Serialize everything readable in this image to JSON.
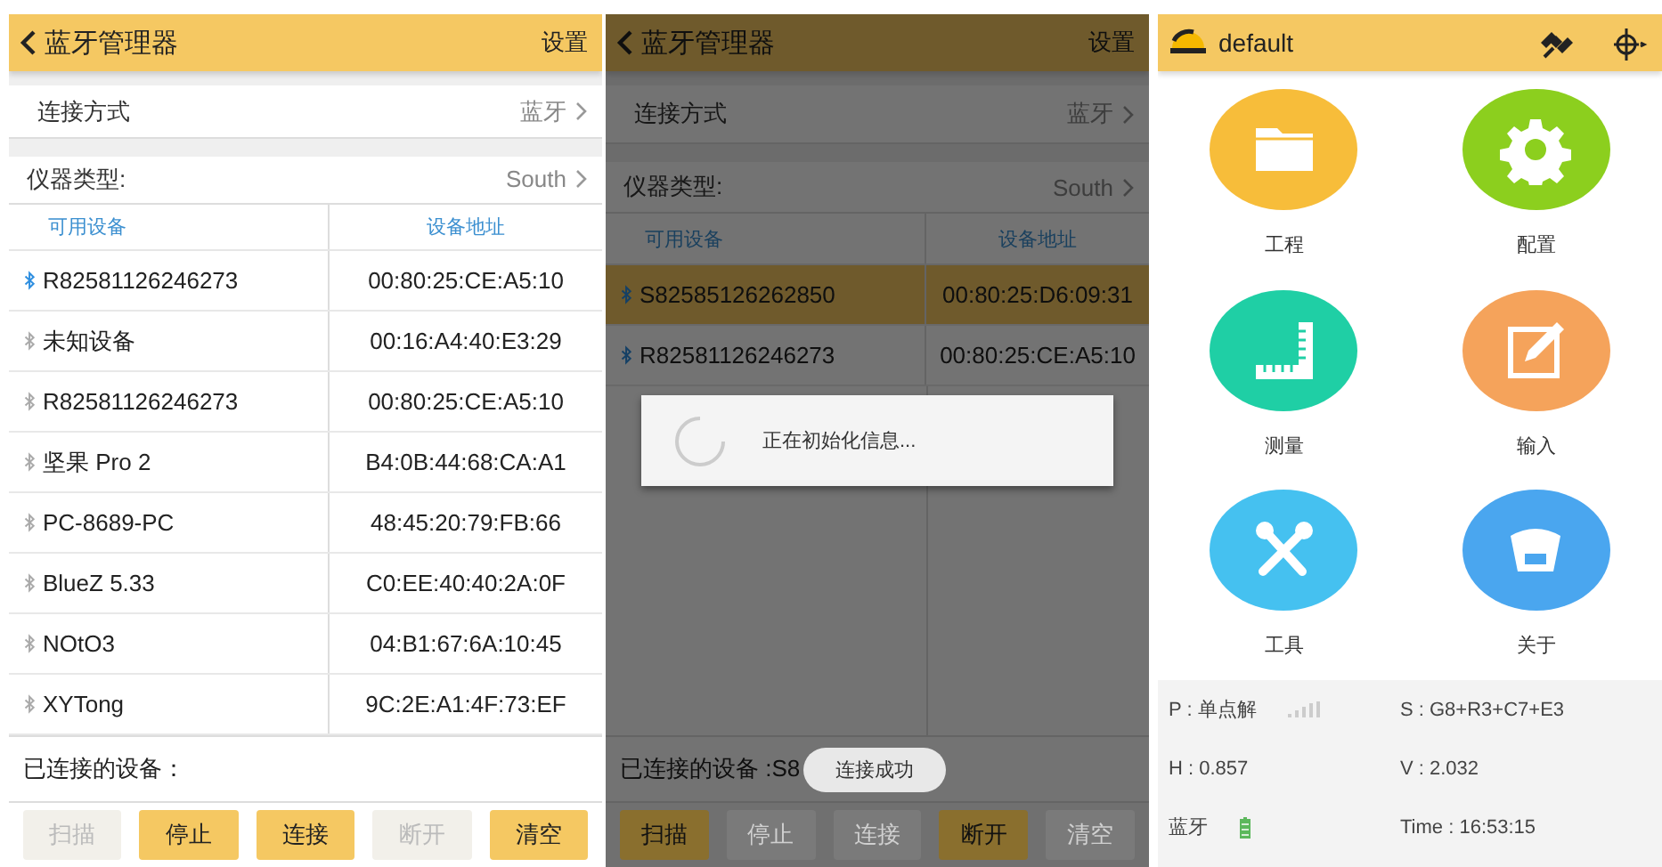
{
  "bluetooth_manager": {
    "title": "蓝牙管理器",
    "action": "设置",
    "dimmed": false,
    "settings": [
      {
        "label": "连接方式",
        "value": "蓝牙"
      },
      {
        "label": "仪器类型:",
        "value": "South"
      }
    ],
    "columns": [
      "可用设备",
      "设备地址"
    ],
    "devices": [
      {
        "name": "R82581126246273",
        "address": "00:80:25:CE:A5:10",
        "paired": true,
        "selected": false
      },
      {
        "name": "未知设备",
        "address": "00:16:A4:40:E3:29",
        "paired": false,
        "selected": false
      },
      {
        "name": "R82581126246273",
        "address": "00:80:25:CE:A5:10",
        "paired": false,
        "selected": false
      },
      {
        "name": "坚果 Pro 2",
        "address": "B4:0B:44:68:CA:A1",
        "paired": false,
        "selected": false
      },
      {
        "name": "PC-8689-PC",
        "address": "48:45:20:79:FB:66",
        "paired": false,
        "selected": false
      },
      {
        "name": "BlueZ 5.33",
        "address": "C0:EE:40:40:2A:0F",
        "paired": false,
        "selected": false
      },
      {
        "name": "NOtO3",
        "address": "04:B1:67:6A:10:45",
        "paired": false,
        "selected": false
      },
      {
        "name": "XYTong",
        "address": "9C:2E:A1:4F:73:EF",
        "paired": false,
        "selected": false
      }
    ],
    "connected_label": "已连接的设备：",
    "buttons": [
      {
        "label": "扫描",
        "disabled": true
      },
      {
        "label": "停止",
        "disabled": false
      },
      {
        "label": "连接",
        "disabled": false
      },
      {
        "label": "断开",
        "disabled": true
      },
      {
        "label": "清空",
        "disabled": false
      }
    ]
  },
  "bluetooth_manager_connecting": {
    "title": "蓝牙管理器",
    "action": "设置",
    "dimmed": true,
    "settings": [
      {
        "label": "连接方式",
        "value": "蓝牙"
      },
      {
        "label": "仪器类型:",
        "value": "South"
      }
    ],
    "columns": [
      "可用设备",
      "设备地址"
    ],
    "devices": [
      {
        "name": "S82585126262850",
        "address": "00:80:25:D6:09:31",
        "paired": true,
        "selected": true
      },
      {
        "name": "R82581126246273",
        "address": "00:80:25:CE:A5:10",
        "paired": true,
        "selected": false
      }
    ],
    "connected_label": "已连接的设备 :S8",
    "toast": "连接成功",
    "dialog": "正在初始化信息...",
    "buttons": [
      {
        "label": "扫描",
        "disabled": false
      },
      {
        "label": "停止",
        "disabled": true
      },
      {
        "label": "连接",
        "disabled": true
      },
      {
        "label": "断开",
        "disabled": false
      },
      {
        "label": "清空",
        "disabled": true
      }
    ]
  },
  "home": {
    "title": "default",
    "tiles": [
      {
        "label": "工程",
        "kind": "folder",
        "color": "#f7bd3a"
      },
      {
        "label": "配置",
        "kind": "gear",
        "color": "#8ccf1e"
      },
      {
        "label": "测量",
        "kind": "ruler",
        "color": "#1fcfa5"
      },
      {
        "label": "输入",
        "kind": "edit",
        "color": "#f5a35b"
      },
      {
        "label": "工具",
        "kind": "tools",
        "color": "#45c1f0"
      },
      {
        "label": "关于",
        "kind": "receiver",
        "color": "#4aa6ef"
      }
    ],
    "status": [
      {
        "text": "P : 单点解",
        "kind": "signal"
      },
      {
        "text": "S : G8+R3+C7+E3",
        "kind": "text"
      },
      {
        "text": "H : 0.857",
        "kind": "text"
      },
      {
        "text": "V : 2.032",
        "kind": "text"
      },
      {
        "text": "蓝牙",
        "kind": "battery"
      },
      {
        "text": "Time :  16:53:15",
        "kind": "text"
      }
    ]
  }
}
